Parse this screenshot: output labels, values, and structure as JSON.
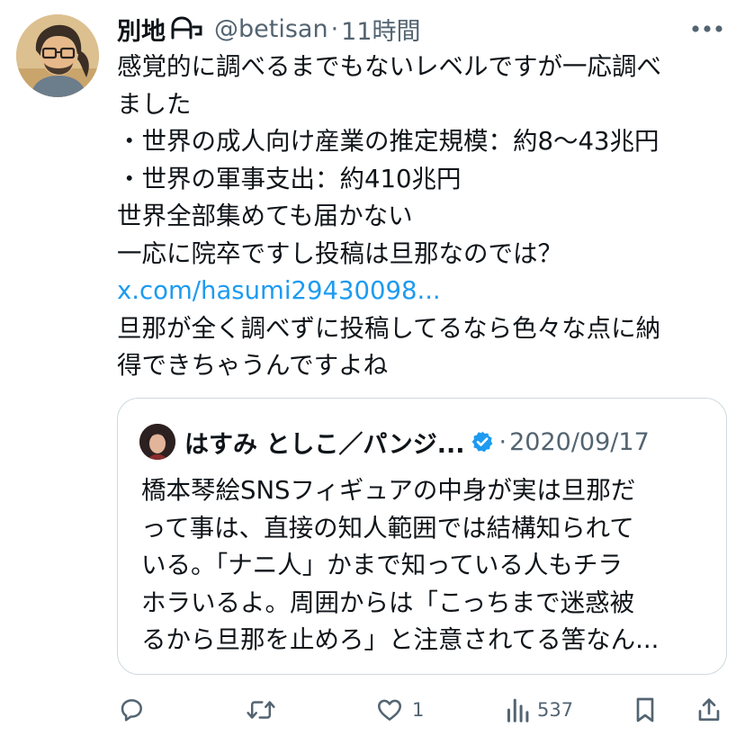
{
  "tweet": {
    "display_name": "別地",
    "name_icon": "head-emoji-icon",
    "handle": "@betisan",
    "separator": "·",
    "time": "11時間",
    "more_icon": "more-icon",
    "lines": [
      "感覚的に調べるまでもないレベルですが一応調べ",
      "ました",
      "・世界の成人向け産業の推定規模：約8〜43兆円",
      "・世界の軍事支出：約410兆円",
      "世界全部集めても届かない",
      "一応に院卒ですし投稿は旦那なのでは？"
    ],
    "link_text": "x.com/hasumi29430098...",
    "lines_after_link": [
      "旦那が全く調べずに投稿してるなら色々な点に納",
      "得できちゃうんですよね"
    ]
  },
  "quote": {
    "display_name": "はすみ としこ／パンジ...",
    "verified_icon": "verified-badge-icon",
    "separator": "·",
    "date": "2020/09/17",
    "lines": [
      "橋本琴絵SNSフィギュアの中身が実は旦那だ",
      "って事は、直接の知人範囲では結構知られて",
      "いる。「ナニ人」かまで知っている人もチラ",
      "ホラいるよ。周囲からは「こっちまで迷惑被",
      "るから旦那を止めろ」と注意されてる筈なん..."
    ]
  },
  "actions": {
    "reply_icon": "reply-icon",
    "retweet_icon": "retweet-icon",
    "like_icon": "like-icon",
    "like_count": "1",
    "views_icon": "views-icon",
    "view_count": "537",
    "bookmark_icon": "bookmark-icon",
    "share_icon": "share-icon"
  },
  "colors": {
    "text": "#0f1419",
    "secondary": "#536471",
    "link": "#1d9bf0",
    "verified": "#1d9bf0",
    "border": "#cfd9de"
  }
}
